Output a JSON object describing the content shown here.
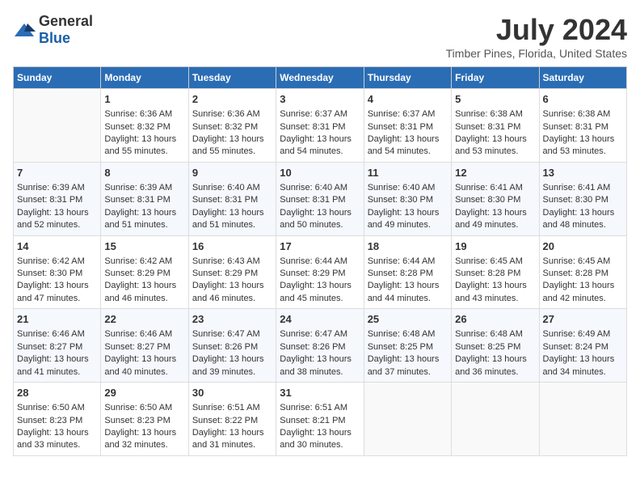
{
  "logo": {
    "text_general": "General",
    "text_blue": "Blue"
  },
  "title": "July 2024",
  "subtitle": "Timber Pines, Florida, United States",
  "days_of_week": [
    "Sunday",
    "Monday",
    "Tuesday",
    "Wednesday",
    "Thursday",
    "Friday",
    "Saturday"
  ],
  "weeks": [
    [
      {
        "day": "",
        "sunrise": "",
        "sunset": "",
        "daylight": ""
      },
      {
        "day": "1",
        "sunrise": "Sunrise: 6:36 AM",
        "sunset": "Sunset: 8:32 PM",
        "daylight": "Daylight: 13 hours and 55 minutes."
      },
      {
        "day": "2",
        "sunrise": "Sunrise: 6:36 AM",
        "sunset": "Sunset: 8:32 PM",
        "daylight": "Daylight: 13 hours and 55 minutes."
      },
      {
        "day": "3",
        "sunrise": "Sunrise: 6:37 AM",
        "sunset": "Sunset: 8:31 PM",
        "daylight": "Daylight: 13 hours and 54 minutes."
      },
      {
        "day": "4",
        "sunrise": "Sunrise: 6:37 AM",
        "sunset": "Sunset: 8:31 PM",
        "daylight": "Daylight: 13 hours and 54 minutes."
      },
      {
        "day": "5",
        "sunrise": "Sunrise: 6:38 AM",
        "sunset": "Sunset: 8:31 PM",
        "daylight": "Daylight: 13 hours and 53 minutes."
      },
      {
        "day": "6",
        "sunrise": "Sunrise: 6:38 AM",
        "sunset": "Sunset: 8:31 PM",
        "daylight": "Daylight: 13 hours and 53 minutes."
      }
    ],
    [
      {
        "day": "7",
        "sunrise": "Sunrise: 6:39 AM",
        "sunset": "Sunset: 8:31 PM",
        "daylight": "Daylight: 13 hours and 52 minutes."
      },
      {
        "day": "8",
        "sunrise": "Sunrise: 6:39 AM",
        "sunset": "Sunset: 8:31 PM",
        "daylight": "Daylight: 13 hours and 51 minutes."
      },
      {
        "day": "9",
        "sunrise": "Sunrise: 6:40 AM",
        "sunset": "Sunset: 8:31 PM",
        "daylight": "Daylight: 13 hours and 51 minutes."
      },
      {
        "day": "10",
        "sunrise": "Sunrise: 6:40 AM",
        "sunset": "Sunset: 8:31 PM",
        "daylight": "Daylight: 13 hours and 50 minutes."
      },
      {
        "day": "11",
        "sunrise": "Sunrise: 6:40 AM",
        "sunset": "Sunset: 8:30 PM",
        "daylight": "Daylight: 13 hours and 49 minutes."
      },
      {
        "day": "12",
        "sunrise": "Sunrise: 6:41 AM",
        "sunset": "Sunset: 8:30 PM",
        "daylight": "Daylight: 13 hours and 49 minutes."
      },
      {
        "day": "13",
        "sunrise": "Sunrise: 6:41 AM",
        "sunset": "Sunset: 8:30 PM",
        "daylight": "Daylight: 13 hours and 48 minutes."
      }
    ],
    [
      {
        "day": "14",
        "sunrise": "Sunrise: 6:42 AM",
        "sunset": "Sunset: 8:30 PM",
        "daylight": "Daylight: 13 hours and 47 minutes."
      },
      {
        "day": "15",
        "sunrise": "Sunrise: 6:42 AM",
        "sunset": "Sunset: 8:29 PM",
        "daylight": "Daylight: 13 hours and 46 minutes."
      },
      {
        "day": "16",
        "sunrise": "Sunrise: 6:43 AM",
        "sunset": "Sunset: 8:29 PM",
        "daylight": "Daylight: 13 hours and 46 minutes."
      },
      {
        "day": "17",
        "sunrise": "Sunrise: 6:44 AM",
        "sunset": "Sunset: 8:29 PM",
        "daylight": "Daylight: 13 hours and 45 minutes."
      },
      {
        "day": "18",
        "sunrise": "Sunrise: 6:44 AM",
        "sunset": "Sunset: 8:28 PM",
        "daylight": "Daylight: 13 hours and 44 minutes."
      },
      {
        "day": "19",
        "sunrise": "Sunrise: 6:45 AM",
        "sunset": "Sunset: 8:28 PM",
        "daylight": "Daylight: 13 hours and 43 minutes."
      },
      {
        "day": "20",
        "sunrise": "Sunrise: 6:45 AM",
        "sunset": "Sunset: 8:28 PM",
        "daylight": "Daylight: 13 hours and 42 minutes."
      }
    ],
    [
      {
        "day": "21",
        "sunrise": "Sunrise: 6:46 AM",
        "sunset": "Sunset: 8:27 PM",
        "daylight": "Daylight: 13 hours and 41 minutes."
      },
      {
        "day": "22",
        "sunrise": "Sunrise: 6:46 AM",
        "sunset": "Sunset: 8:27 PM",
        "daylight": "Daylight: 13 hours and 40 minutes."
      },
      {
        "day": "23",
        "sunrise": "Sunrise: 6:47 AM",
        "sunset": "Sunset: 8:26 PM",
        "daylight": "Daylight: 13 hours and 39 minutes."
      },
      {
        "day": "24",
        "sunrise": "Sunrise: 6:47 AM",
        "sunset": "Sunset: 8:26 PM",
        "daylight": "Daylight: 13 hours and 38 minutes."
      },
      {
        "day": "25",
        "sunrise": "Sunrise: 6:48 AM",
        "sunset": "Sunset: 8:25 PM",
        "daylight": "Daylight: 13 hours and 37 minutes."
      },
      {
        "day": "26",
        "sunrise": "Sunrise: 6:48 AM",
        "sunset": "Sunset: 8:25 PM",
        "daylight": "Daylight: 13 hours and 36 minutes."
      },
      {
        "day": "27",
        "sunrise": "Sunrise: 6:49 AM",
        "sunset": "Sunset: 8:24 PM",
        "daylight": "Daylight: 13 hours and 34 minutes."
      }
    ],
    [
      {
        "day": "28",
        "sunrise": "Sunrise: 6:50 AM",
        "sunset": "Sunset: 8:23 PM",
        "daylight": "Daylight: 13 hours and 33 minutes."
      },
      {
        "day": "29",
        "sunrise": "Sunrise: 6:50 AM",
        "sunset": "Sunset: 8:23 PM",
        "daylight": "Daylight: 13 hours and 32 minutes."
      },
      {
        "day": "30",
        "sunrise": "Sunrise: 6:51 AM",
        "sunset": "Sunset: 8:22 PM",
        "daylight": "Daylight: 13 hours and 31 minutes."
      },
      {
        "day": "31",
        "sunrise": "Sunrise: 6:51 AM",
        "sunset": "Sunset: 8:21 PM",
        "daylight": "Daylight: 13 hours and 30 minutes."
      },
      {
        "day": "",
        "sunrise": "",
        "sunset": "",
        "daylight": ""
      },
      {
        "day": "",
        "sunrise": "",
        "sunset": "",
        "daylight": ""
      },
      {
        "day": "",
        "sunrise": "",
        "sunset": "",
        "daylight": ""
      }
    ]
  ]
}
